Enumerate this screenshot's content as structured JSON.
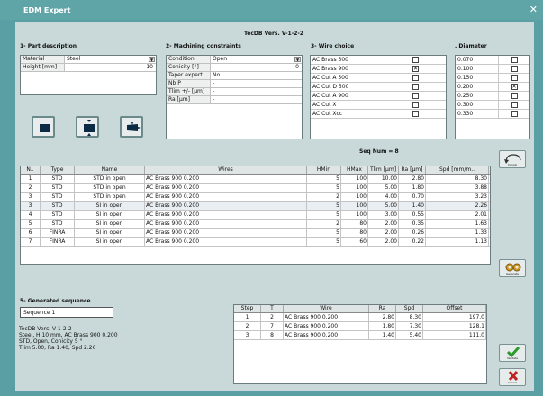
{
  "window": {
    "title": "EDM Expert",
    "close": "✕",
    "version": "TecDB Vers. V-1-2-2"
  },
  "part": {
    "title": "1- Part description",
    "rows": [
      {
        "key": "Material",
        "value": "Steel",
        "dropdown": true
      },
      {
        "key": "Height  [mm]",
        "value": "10",
        "dropdown": false
      }
    ]
  },
  "machining": {
    "title": "2- Machining constraints",
    "rows": [
      {
        "key": "Condition",
        "value": "Open",
        "dropdown": true
      },
      {
        "key": "Conicity  [°]",
        "value": "0",
        "dropdown": false
      },
      {
        "key": "Taper expert",
        "value": "No",
        "dropdown": false
      },
      {
        "key": "Nb P",
        "value": "-",
        "dropdown": false
      },
      {
        "key": "Tlim +/-  [µm]",
        "value": "-",
        "dropdown": false
      },
      {
        "key": "Ra  [µm]",
        "value": "-",
        "dropdown": false
      }
    ]
  },
  "wire": {
    "title": "3- Wire choice",
    "items": [
      {
        "name": "AC Brass 500",
        "checked": false
      },
      {
        "name": "AC Brass 900",
        "checked": true
      },
      {
        "name": "AC Cut A 500",
        "checked": false
      },
      {
        "name": "AC Cut D 500",
        "checked": false
      },
      {
        "name": "AC Cut A 900",
        "checked": false
      },
      {
        "name": "AC Cut X",
        "checked": false
      },
      {
        "name": "AC Cut Xcc",
        "checked": false
      }
    ]
  },
  "diameter": {
    "title": ". Diameter",
    "items": [
      {
        "value": "0.070",
        "checked": false
      },
      {
        "value": "0.100",
        "checked": false
      },
      {
        "value": "0.150",
        "checked": false
      },
      {
        "value": "0.200",
        "checked": true
      },
      {
        "value": "0.250",
        "checked": false
      },
      {
        "value": "0.300",
        "checked": false
      },
      {
        "value": "0.330",
        "checked": false
      }
    ]
  },
  "seq_num": "Seq Num = 8",
  "results": {
    "headers": [
      "N..",
      "Type",
      "Name",
      "Wires",
      "HMin",
      "HMax",
      "Tlim [µm]",
      "Ra [µm]",
      "Spd [mm/m.."
    ],
    "rows": [
      [
        "1",
        "STD",
        "STD in open",
        "AC Brass 900 0.200",
        "5",
        "100",
        "10.00",
        "2.80",
        "8.30"
      ],
      [
        "2",
        "STD",
        "STD in open",
        "AC Brass 900 0.200",
        "5",
        "100",
        "5.00",
        "1.80",
        "3.88"
      ],
      [
        "3",
        "STD",
        "STD in open",
        "AC Brass 900 0.200",
        "2",
        "100",
        "4.00",
        "0.70",
        "3.23"
      ],
      [
        "3",
        "STD",
        "SI in open",
        "AC Brass 900 0.200",
        "5",
        "100",
        "5.00",
        "1.40",
        "2.26"
      ],
      [
        "4",
        "STD",
        "SI in open",
        "AC Brass 900 0.200",
        "5",
        "100",
        "3.00",
        "0.55",
        "2.01"
      ],
      [
        "5",
        "STD",
        "SI in open",
        "AC Brass 900 0.200",
        "2",
        "80",
        "2.00",
        "0.35",
        "1.63"
      ],
      [
        "6",
        "FINRA",
        "SI in open",
        "AC Brass 900 0.200",
        "5",
        "80",
        "2.00",
        "0.26",
        "1.33"
      ],
      [
        "7",
        "FINRA",
        "SI in open",
        "AC Brass 900 0.200",
        "5",
        "60",
        "2.00",
        "0.22",
        "1.13"
      ]
    ]
  },
  "generated": {
    "title": "5- Generated sequence",
    "sequence_name": "Sequence 1",
    "notes": [
      "TecDB Vers.  V-1-2-2",
      "Steel,  H 10 mm, AC Brass 900 0.200",
      "STD, Open,  Conicity 5 °",
      "Tlim 5.00,  Ra 1.40,  Spd 2.26"
    ]
  },
  "steps": {
    "headers": [
      "Step",
      "T",
      "Wire",
      "Ra",
      "Spd",
      "Offset"
    ],
    "rows": [
      [
        "1",
        "2",
        "AC Brass 900 0.200",
        "2.80",
        "8.30",
        "197.0"
      ],
      [
        "2",
        "7",
        "AC Brass 900 0.200",
        "1.80",
        "7.30",
        "128.1"
      ],
      [
        "3",
        "8",
        "AC Brass 900 0.200",
        "1.40",
        "5.40",
        "111.0"
      ]
    ]
  },
  "buttons": {
    "cancel_top": "Cancel",
    "generate": "Generate",
    "validate": "Validate",
    "cancel": "Cancel"
  },
  "colors": {
    "titlebar": "#5fa5a8",
    "panel": "#c9d9da",
    "validate": "#2d9a2d",
    "cancel": "#c0231f"
  }
}
